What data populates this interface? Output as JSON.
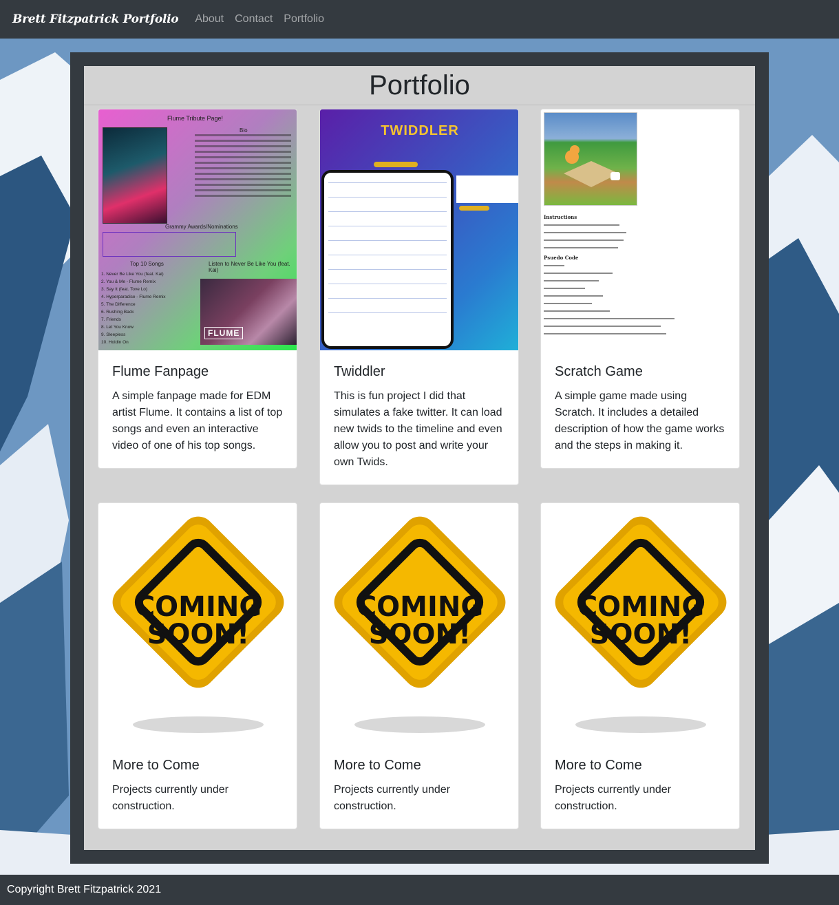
{
  "navbar": {
    "brand": "Brett Fitzpatrick Portfolio",
    "links": [
      "About",
      "Contact",
      "Portfolio"
    ]
  },
  "page": {
    "title": "Portfolio"
  },
  "cards": [
    {
      "title": "Flume Fanpage",
      "text": "A simple fanpage made for EDM artist Flume. It contains a list of top songs and even an interactive video of one of his top songs.",
      "image": "flume-screenshot"
    },
    {
      "title": "Twiddler",
      "text": "This is fun project I did that simulates a fake twitter. It can load new twids to the timeline and even allow you to post and write your own Twids.",
      "image": "twiddler-screenshot"
    },
    {
      "title": "Scratch Game",
      "text": "A simple game made using Scratch. It includes a detailed description of how the game works and the steps in making it.",
      "image": "scratch-screenshot"
    },
    {
      "title": "More to Come",
      "text": "Projects currently under construction.",
      "image": "coming-soon-sign"
    },
    {
      "title": "More to Come",
      "text": "Projects currently under construction.",
      "image": "coming-soon-sign"
    },
    {
      "title": "More to Come",
      "text": "Projects currently under construction.",
      "image": "coming-soon-sign"
    }
  ],
  "thumbnails": {
    "flume": {
      "heading": "Flume Tribute Page!",
      "bio": "Bio",
      "awards_heading": "Grammy Awards/Nominations",
      "songs_heading": "Top 10 Songs",
      "listen_heading": "Listen to Never Be Like You (feat. Kai)",
      "songs": [
        "1. Never Be Like You (feat. Kai)",
        "2. You & Me - Flume Remix",
        "3. Say It (feat. Tove Lo)",
        "4. Hyperparadise - Flume Remix",
        "5. The Difference",
        "6. Rushing Back",
        "7. Friends",
        "8. Let You Know",
        "9. Sleepless",
        "10. Holdin On"
      ],
      "video_logo": "FLUME"
    },
    "twiddler": {
      "title": "TWIDDLER"
    },
    "scratch": {
      "instructions_heading": "Instructions",
      "pseudo_heading": "Psuedo Code"
    },
    "coming_soon": {
      "line1": "COMING",
      "line2": "SOON!"
    }
  },
  "footer": {
    "text": "Copyright Brett Fitzpatrick 2021"
  },
  "colors": {
    "navbar": "#343a40",
    "panel": "#d3d3d3",
    "sign_yellow": "#f5b800"
  }
}
